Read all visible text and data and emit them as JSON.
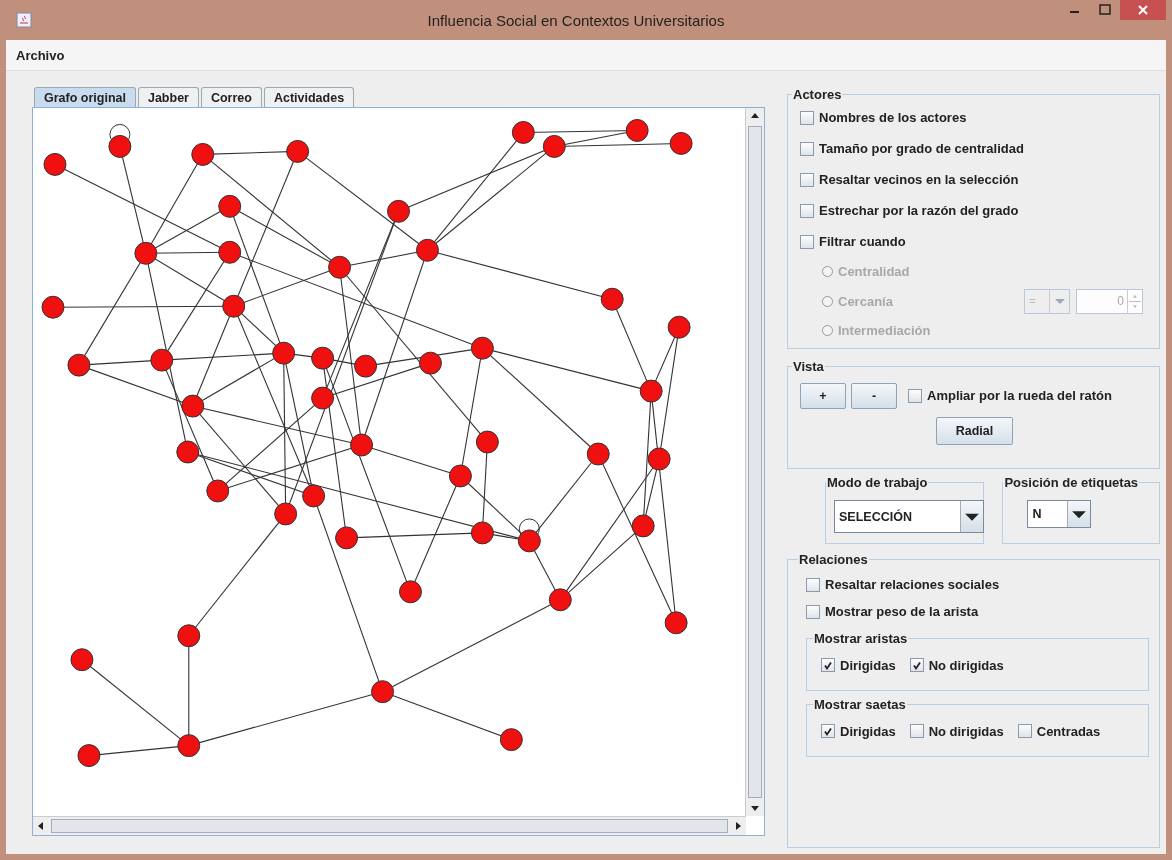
{
  "window": {
    "title": "Influencia Social en Contextos Universitarios"
  },
  "menu": [
    "Archivo"
  ],
  "tabs": [
    {
      "label": "Grafo original",
      "selected": true
    },
    {
      "label": "Jabber",
      "selected": false
    },
    {
      "label": "Correo",
      "selected": false
    },
    {
      "label": "Actividades",
      "selected": false
    }
  ],
  "actores": {
    "title": "Actores",
    "options": [
      {
        "label": "Nombres de los actores",
        "checked": false
      },
      {
        "label": "Tamaño por grado de centralidad",
        "checked": false
      },
      {
        "label": "Resaltar vecinos en la selección",
        "checked": false
      },
      {
        "label": "Estrechar por la razón del grado",
        "checked": false
      },
      {
        "label": "Filtrar cuando",
        "checked": false
      }
    ],
    "filters": [
      {
        "label": "Centralidad",
        "selected": false,
        "disabled": true
      },
      {
        "label": "Cercanía",
        "selected": false,
        "disabled": true
      },
      {
        "label": "Intermediación",
        "selected": false,
        "disabled": true
      }
    ],
    "comparator": {
      "value": "=",
      "disabled": true
    },
    "threshold": {
      "value": "0",
      "disabled": true
    }
  },
  "vista": {
    "title": "Vista",
    "zoom_in": "+",
    "zoom_out": "-",
    "wheel_zoom": {
      "label": "Ampliar por la rueda del ratón",
      "checked": false
    },
    "layout_button": "Radial"
  },
  "modo": {
    "title": "Modo de trabajo",
    "value": "SELECCIÓN"
  },
  "posicion": {
    "title": "Posición de etiquetas",
    "value": "N"
  },
  "relaciones": {
    "title": "Relaciones",
    "options": [
      {
        "label": "Resaltar relaciones sociales",
        "checked": false
      },
      {
        "label": "Mostrar peso de la arista",
        "checked": false
      }
    ],
    "groups": [
      {
        "title": "Mostrar aristas",
        "options": [
          {
            "label": "Dirigidas",
            "checked": true
          },
          {
            "label": "No dirigidas",
            "checked": true
          }
        ]
      },
      {
        "title": "Mostrar saetas",
        "options": [
          {
            "label": "Dirigidas",
            "checked": true
          },
          {
            "label": "No dirigidas",
            "checked": false
          },
          {
            "label": "Centradas",
            "checked": false
          }
        ]
      }
    ]
  }
}
